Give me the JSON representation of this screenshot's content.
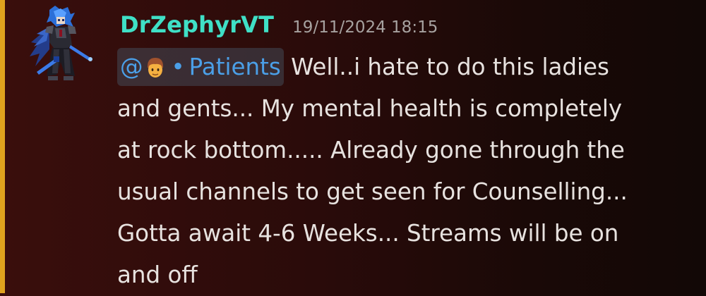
{
  "message": {
    "username": "DrZephyrVT",
    "timestamp": "19/11/2024 18:15",
    "mention": {
      "at": "@",
      "emoji": "boy-emoji-icon",
      "separator": "•",
      "channel": "Patients"
    },
    "lines": [
      "Well..i hate to do this ladies",
      "and gents... My mental health is completely",
      "at rock bottom..... Already gone through the",
      "usual channels to get seen for Counselling...",
      "Gotta await 4-6 Weeks... Streams will be on",
      "and off"
    ]
  },
  "colors": {
    "username": "#3fe0c6",
    "mention": "#4b9fe7",
    "text": "#e7e2df",
    "timestamp": "#a7a2a0",
    "accent_bar": "#e0a21e"
  }
}
